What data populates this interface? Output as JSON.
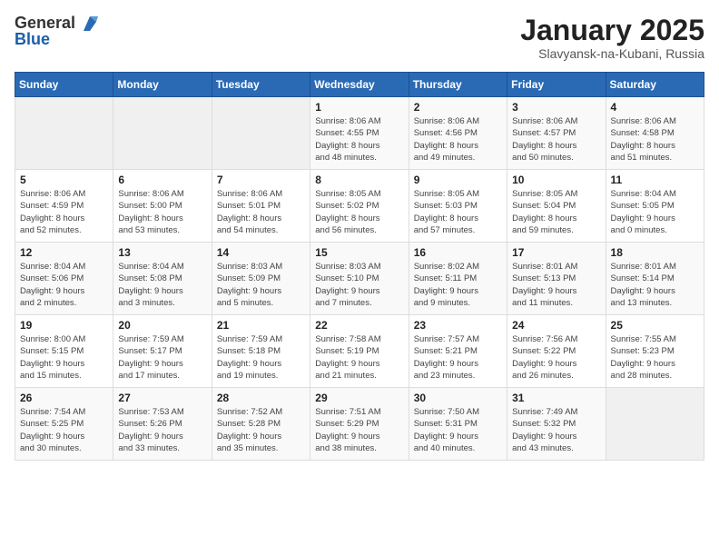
{
  "logo": {
    "general": "General",
    "blue": "Blue"
  },
  "header": {
    "month": "January 2025",
    "location": "Slavyansk-na-Kubani, Russia"
  },
  "weekdays": [
    "Sunday",
    "Monday",
    "Tuesday",
    "Wednesday",
    "Thursday",
    "Friday",
    "Saturday"
  ],
  "weeks": [
    [
      {
        "day": "",
        "info": ""
      },
      {
        "day": "",
        "info": ""
      },
      {
        "day": "",
        "info": ""
      },
      {
        "day": "1",
        "info": "Sunrise: 8:06 AM\nSunset: 4:55 PM\nDaylight: 8 hours\nand 48 minutes."
      },
      {
        "day": "2",
        "info": "Sunrise: 8:06 AM\nSunset: 4:56 PM\nDaylight: 8 hours\nand 49 minutes."
      },
      {
        "day": "3",
        "info": "Sunrise: 8:06 AM\nSunset: 4:57 PM\nDaylight: 8 hours\nand 50 minutes."
      },
      {
        "day": "4",
        "info": "Sunrise: 8:06 AM\nSunset: 4:58 PM\nDaylight: 8 hours\nand 51 minutes."
      }
    ],
    [
      {
        "day": "5",
        "info": "Sunrise: 8:06 AM\nSunset: 4:59 PM\nDaylight: 8 hours\nand 52 minutes."
      },
      {
        "day": "6",
        "info": "Sunrise: 8:06 AM\nSunset: 5:00 PM\nDaylight: 8 hours\nand 53 minutes."
      },
      {
        "day": "7",
        "info": "Sunrise: 8:06 AM\nSunset: 5:01 PM\nDaylight: 8 hours\nand 54 minutes."
      },
      {
        "day": "8",
        "info": "Sunrise: 8:05 AM\nSunset: 5:02 PM\nDaylight: 8 hours\nand 56 minutes."
      },
      {
        "day": "9",
        "info": "Sunrise: 8:05 AM\nSunset: 5:03 PM\nDaylight: 8 hours\nand 57 minutes."
      },
      {
        "day": "10",
        "info": "Sunrise: 8:05 AM\nSunset: 5:04 PM\nDaylight: 8 hours\nand 59 minutes."
      },
      {
        "day": "11",
        "info": "Sunrise: 8:04 AM\nSunset: 5:05 PM\nDaylight: 9 hours\nand 0 minutes."
      }
    ],
    [
      {
        "day": "12",
        "info": "Sunrise: 8:04 AM\nSunset: 5:06 PM\nDaylight: 9 hours\nand 2 minutes."
      },
      {
        "day": "13",
        "info": "Sunrise: 8:04 AM\nSunset: 5:08 PM\nDaylight: 9 hours\nand 3 minutes."
      },
      {
        "day": "14",
        "info": "Sunrise: 8:03 AM\nSunset: 5:09 PM\nDaylight: 9 hours\nand 5 minutes."
      },
      {
        "day": "15",
        "info": "Sunrise: 8:03 AM\nSunset: 5:10 PM\nDaylight: 9 hours\nand 7 minutes."
      },
      {
        "day": "16",
        "info": "Sunrise: 8:02 AM\nSunset: 5:11 PM\nDaylight: 9 hours\nand 9 minutes."
      },
      {
        "day": "17",
        "info": "Sunrise: 8:01 AM\nSunset: 5:13 PM\nDaylight: 9 hours\nand 11 minutes."
      },
      {
        "day": "18",
        "info": "Sunrise: 8:01 AM\nSunset: 5:14 PM\nDaylight: 9 hours\nand 13 minutes."
      }
    ],
    [
      {
        "day": "19",
        "info": "Sunrise: 8:00 AM\nSunset: 5:15 PM\nDaylight: 9 hours\nand 15 minutes."
      },
      {
        "day": "20",
        "info": "Sunrise: 7:59 AM\nSunset: 5:17 PM\nDaylight: 9 hours\nand 17 minutes."
      },
      {
        "day": "21",
        "info": "Sunrise: 7:59 AM\nSunset: 5:18 PM\nDaylight: 9 hours\nand 19 minutes."
      },
      {
        "day": "22",
        "info": "Sunrise: 7:58 AM\nSunset: 5:19 PM\nDaylight: 9 hours\nand 21 minutes."
      },
      {
        "day": "23",
        "info": "Sunrise: 7:57 AM\nSunset: 5:21 PM\nDaylight: 9 hours\nand 23 minutes."
      },
      {
        "day": "24",
        "info": "Sunrise: 7:56 AM\nSunset: 5:22 PM\nDaylight: 9 hours\nand 26 minutes."
      },
      {
        "day": "25",
        "info": "Sunrise: 7:55 AM\nSunset: 5:23 PM\nDaylight: 9 hours\nand 28 minutes."
      }
    ],
    [
      {
        "day": "26",
        "info": "Sunrise: 7:54 AM\nSunset: 5:25 PM\nDaylight: 9 hours\nand 30 minutes."
      },
      {
        "day": "27",
        "info": "Sunrise: 7:53 AM\nSunset: 5:26 PM\nDaylight: 9 hours\nand 33 minutes."
      },
      {
        "day": "28",
        "info": "Sunrise: 7:52 AM\nSunset: 5:28 PM\nDaylight: 9 hours\nand 35 minutes."
      },
      {
        "day": "29",
        "info": "Sunrise: 7:51 AM\nSunset: 5:29 PM\nDaylight: 9 hours\nand 38 minutes."
      },
      {
        "day": "30",
        "info": "Sunrise: 7:50 AM\nSunset: 5:31 PM\nDaylight: 9 hours\nand 40 minutes."
      },
      {
        "day": "31",
        "info": "Sunrise: 7:49 AM\nSunset: 5:32 PM\nDaylight: 9 hours\nand 43 minutes."
      },
      {
        "day": "",
        "info": ""
      }
    ]
  ]
}
